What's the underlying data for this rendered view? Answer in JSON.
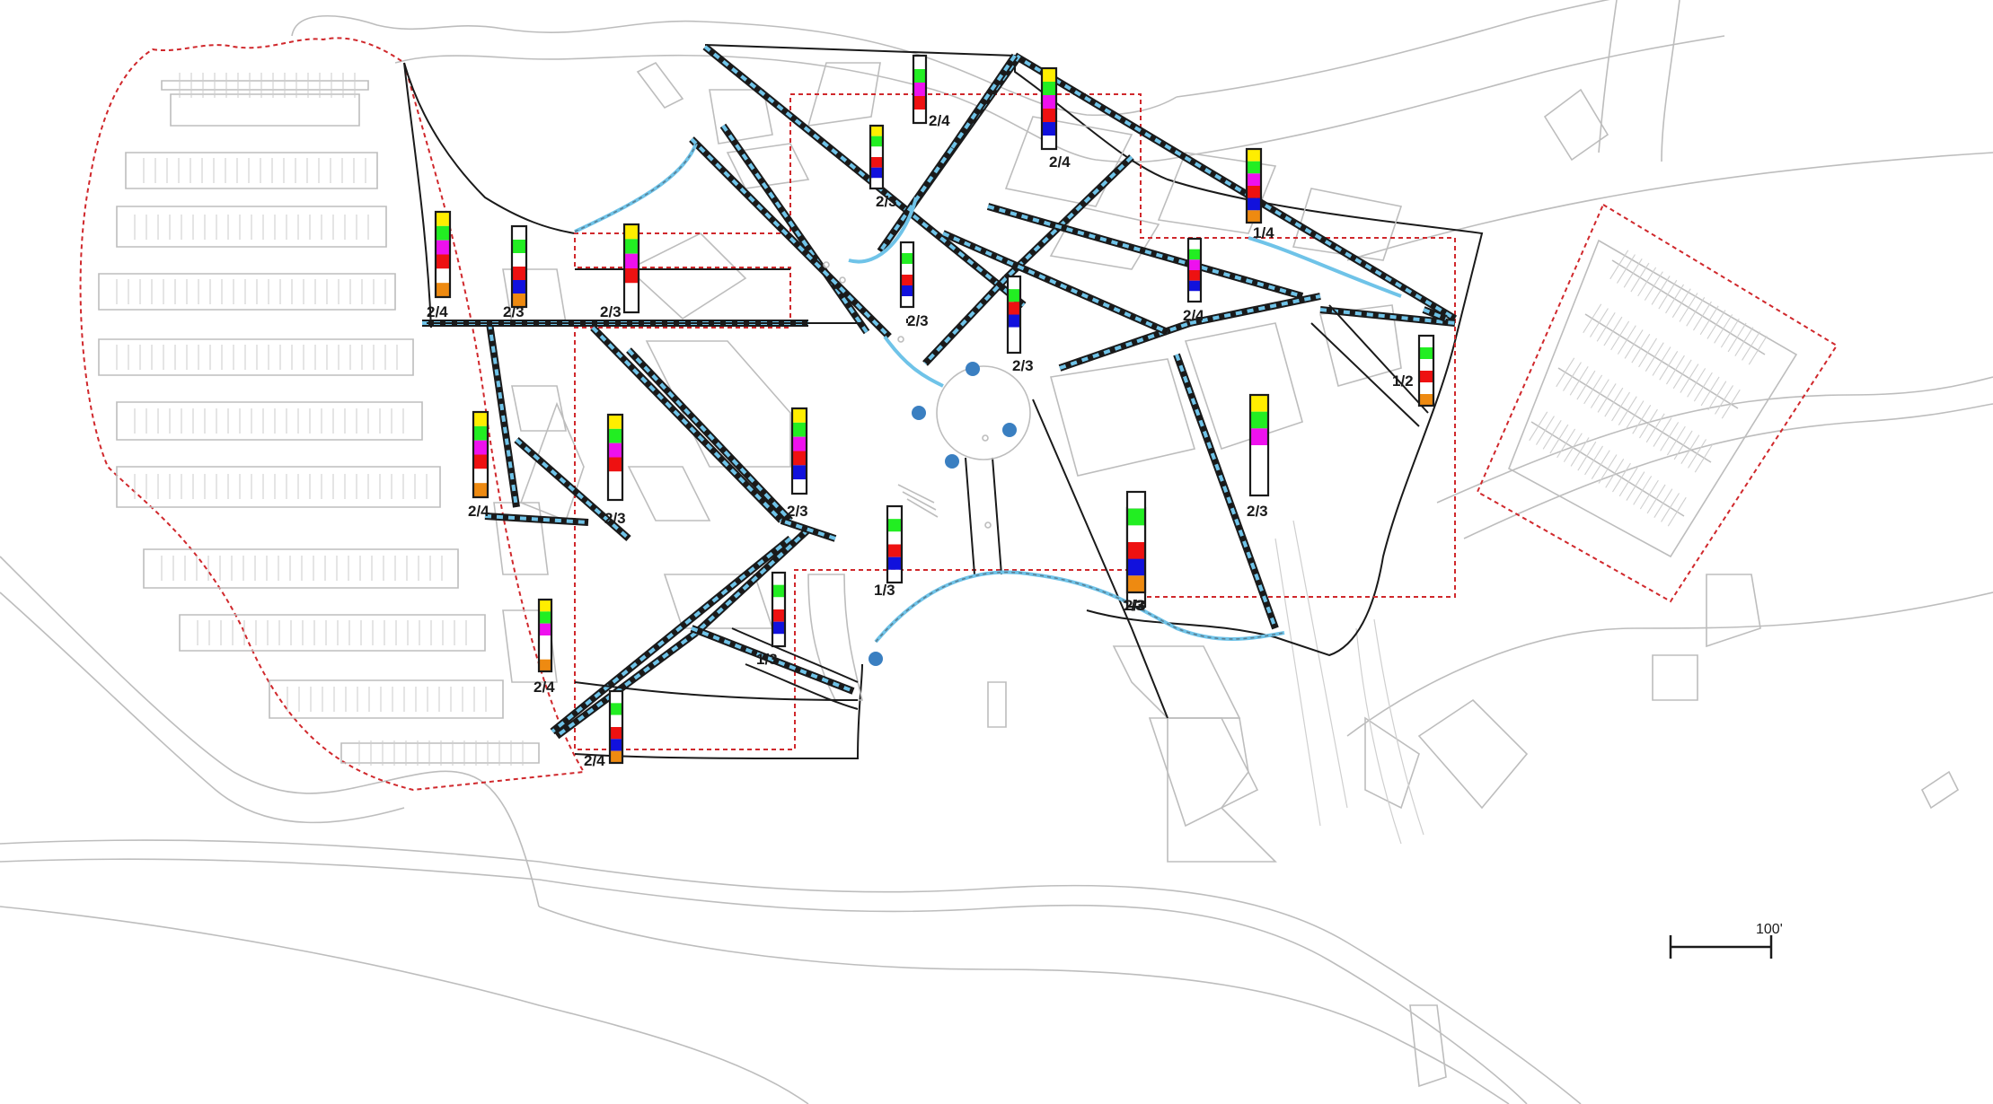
{
  "map": {
    "scale_bar": {
      "label": "100'"
    },
    "colors": {
      "background": "#ffffff",
      "context_lines": "#bdbdbd",
      "site_outline": "#1a1a1a",
      "zone_boundary": "#d0282c",
      "street_highlight": "#6fc3e8",
      "node_marker": "#3a7fc1",
      "segment_palette": {
        "yellow": "#ffee00",
        "green": "#22ee22",
        "magenta": "#ee11ee",
        "red": "#ee1111",
        "blue": "#1111dd",
        "orange": "#ee8a11",
        "white": "#ffffff"
      }
    },
    "bars": [
      {
        "label": "2/4",
        "segments": [
          "white",
          "green",
          "magenta",
          "red",
          "white"
        ]
      },
      {
        "label": "2/4",
        "segments": [
          "yellow",
          "green",
          "magenta",
          "red",
          "blue",
          "white"
        ]
      },
      {
        "label": "2/3",
        "segments": [
          "yellow",
          "green",
          "white",
          "red",
          "blue",
          "white"
        ]
      },
      {
        "label": "2/3",
        "segments": [
          "white",
          "green",
          "white",
          "red",
          "blue",
          "white"
        ]
      },
      {
        "label": "2/4",
        "segments": [
          "yellow",
          "green",
          "magenta",
          "red",
          "white",
          "orange"
        ]
      },
      {
        "label": "2/3",
        "segments": [
          "white",
          "green",
          "white",
          "red",
          "blue",
          "orange"
        ]
      },
      {
        "label": "2/3",
        "segments": [
          "yellow",
          "green",
          "magenta",
          "red",
          "white",
          "white"
        ]
      },
      {
        "label": "2/3",
        "segments": [
          "white",
          "green",
          "red",
          "blue",
          "white",
          "white"
        ]
      },
      {
        "label": "2/3",
        "segments": [
          "white",
          "green",
          "white",
          "red",
          "white",
          "white"
        ]
      },
      {
        "label": "1/4",
        "segments": [
          "yellow",
          "green",
          "magenta",
          "red",
          "blue",
          "orange"
        ]
      },
      {
        "label": "2/4",
        "segments": [
          "white",
          "green",
          "magenta",
          "red",
          "blue",
          "white"
        ]
      },
      {
        "label": "1/2",
        "segments": [
          "white",
          "green",
          "white",
          "red",
          "white",
          "orange"
        ]
      },
      {
        "label": "2/4",
        "segments": [
          "yellow",
          "green",
          "magenta",
          "red",
          "white",
          "orange"
        ]
      },
      {
        "label": "2/3",
        "segments": [
          "yellow",
          "green",
          "magenta",
          "red",
          "white",
          "white"
        ]
      },
      {
        "label": "2/3",
        "segments": [
          "yellow",
          "green",
          "magenta",
          "red",
          "blue",
          "white"
        ]
      },
      {
        "label": "2/3",
        "segments": [
          "yellow",
          "green",
          "magenta",
          "white",
          "white",
          "white"
        ]
      },
      {
        "label": "1/3",
        "segments": [
          "white",
          "green",
          "white",
          "red",
          "blue",
          "white"
        ]
      },
      {
        "label": "1/3",
        "segments": [
          "white",
          "green",
          "white",
          "red",
          "blue",
          "orange"
        ]
      },
      {
        "label": "1/3",
        "segments": [
          "white",
          "green",
          "white",
          "red",
          "blue",
          "white"
        ]
      },
      {
        "label": "2/4",
        "segments": [
          "yellow",
          "green",
          "magenta",
          "white",
          "white",
          "orange"
        ]
      },
      {
        "label": "2/4",
        "segments": [
          "white",
          "green",
          "white",
          "red",
          "blue",
          "orange"
        ]
      }
    ]
  }
}
